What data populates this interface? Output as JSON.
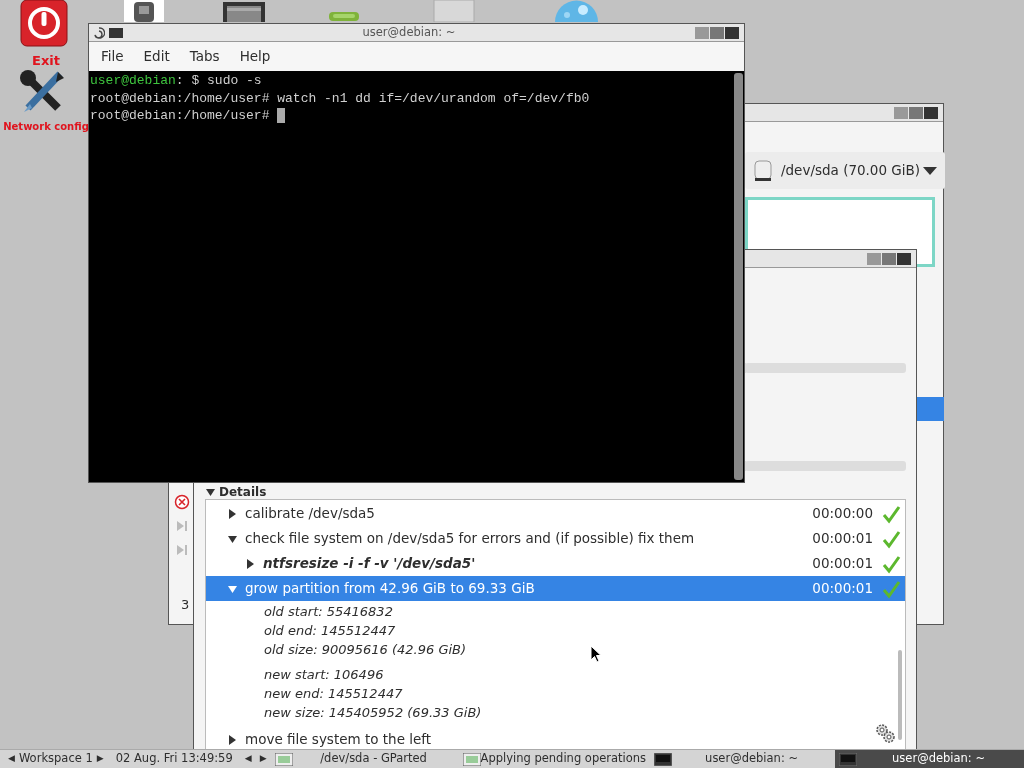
{
  "desktop_icons": [
    {
      "kind": "power",
      "label": "Exit"
    },
    {
      "kind": "tools",
      "label": "Network config"
    }
  ],
  "gparted": {
    "device": "/dev/sda (70.00 GiB)",
    "status_text": "3"
  },
  "progress_dialog": {
    "progress_bars": [
      {
        "level": 0
      },
      {
        "level": 0
      }
    ],
    "details_label": "Details",
    "operations": [
      {
        "kind": "operation",
        "text": "calibrate /dev/sda5",
        "time": "00:00:00",
        "expanded": false,
        "selected": false
      },
      {
        "kind": "operation",
        "text": "check file system on /dev/sda5 for errors and (if possible) fix them",
        "time": "00:00:01",
        "expanded": true,
        "selected": false,
        "children": [
          {
            "kind": "command",
            "text": "ntfsresize -i -f -v '/dev/sda5'",
            "time": "00:00:01",
            "expanded": false,
            "selected": false
          }
        ]
      },
      {
        "kind": "operation",
        "text": "grow partition from 42.96 GiB to 69.33 GiB",
        "time": "00:00:01",
        "expanded": true,
        "selected": true,
        "children": [
          {
            "kind": "info",
            "lines": [
              "old start: 55416832",
              "old end: 145512447",
              "old size: 90095616 (42.96 GiB)"
            ]
          },
          {
            "kind": "info",
            "lines": [
              "new start: 106496",
              "new end: 145512447",
              "new size: 145405952 (69.33 GiB)"
            ]
          }
        ]
      },
      {
        "kind": "operation",
        "text": "move file system to the left",
        "expanded": false,
        "selected": false
      }
    ]
  },
  "terminal": {
    "title": "user@debian: ~",
    "menu": [
      "File",
      "Edit",
      "Tabs",
      "Help"
    ],
    "lines": [
      {
        "prompt": "user@debian",
        "text": ": $ sudo -s"
      },
      {
        "text": "root@debian:/home/user# watch -n1 dd if=/dev/urandom of=/dev/fb0"
      },
      {
        "text": "root@debian:/home/user# ",
        "cursor": true
      }
    ]
  },
  "taskbar": {
    "workspace": {
      "prev": "◀",
      "label": "Workspace 1",
      "next": "▶"
    },
    "clock": "02 Aug. Fri 13:49:59",
    "scroll": {
      "prev": "◀",
      "next": "▶"
    },
    "tasks": [
      {
        "kind": "gparted",
        "label": "/dev/sda - GParted",
        "selected": false
      },
      {
        "kind": "gparted",
        "label": "Applying pending operations",
        "selected": false
      },
      {
        "kind": "terminal",
        "label": "user@debian: ~",
        "selected": false
      },
      {
        "kind": "terminal",
        "label": "user@debian: ~",
        "selected": true
      }
    ]
  }
}
